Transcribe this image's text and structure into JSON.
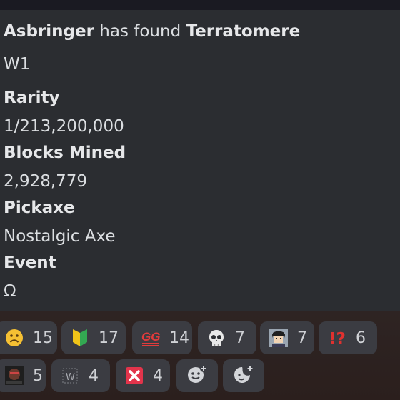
{
  "embed": {
    "player": "Asbringer",
    "found_text": " has found ",
    "item": "Terratomere",
    "world": "W1",
    "fields": [
      {
        "label": "Rarity",
        "value": "1/213,200,000"
      },
      {
        "label": "Blocks Mined",
        "value": "2,928,779"
      },
      {
        "label": "Pickaxe",
        "value": "Nostalgic Axe"
      },
      {
        "label": "Event",
        "value": "Ω"
      }
    ]
  },
  "reactions": [
    {
      "icon": "frowning-face-icon",
      "count": "15"
    },
    {
      "icon": "japanese-beginner-symbol-icon",
      "count": "17"
    },
    {
      "icon": "gg-emoji-icon",
      "count": "14"
    },
    {
      "icon": "skull-icon",
      "count": "7"
    },
    {
      "icon": "custom-avatar-emoji-icon",
      "count": "7"
    },
    {
      "icon": "exclamation-question-mark-icon",
      "count": "6"
    },
    {
      "icon": "custom-dark-face-emoji-icon",
      "count": "5"
    },
    {
      "icon": "w-emoji-icon",
      "count": "4"
    },
    {
      "icon": "cross-mark-button-icon",
      "count": "4"
    }
  ],
  "add_reaction_icons": [
    "add-reaction-icon",
    "add-super-reaction-icon"
  ],
  "colors": {
    "background": "#313338",
    "embed_background": "#2b2d31",
    "reaction_background": "#3b3c42",
    "text": "#dbdee1"
  }
}
